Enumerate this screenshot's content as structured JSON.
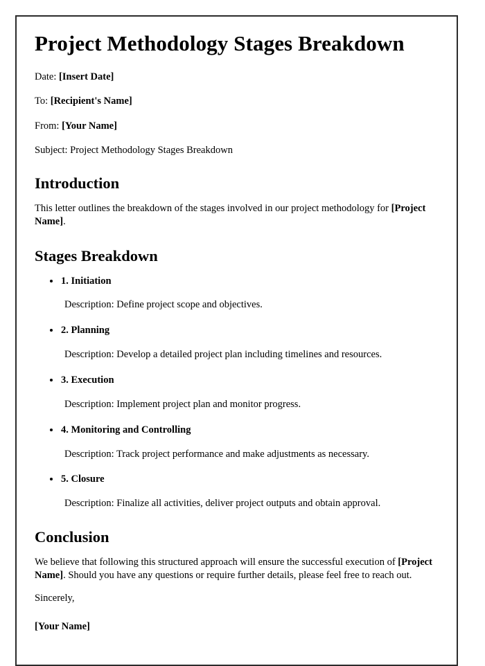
{
  "document": {
    "title": "Project Methodology Stages Breakdown",
    "meta": [
      {
        "label": "Date:",
        "value": "[Insert Date]",
        "value_bold": true
      },
      {
        "label": "To:",
        "value": "[Recipient's Name]",
        "value_bold": true
      },
      {
        "label": "From:",
        "value": "[Your Name]",
        "value_bold": true
      },
      {
        "label": "Subject:",
        "value": "Project Methodology Stages Breakdown",
        "value_bold": false
      }
    ],
    "introduction": {
      "heading": "Introduction",
      "text_before": "This letter outlines the breakdown of the stages involved in our project methodology for ",
      "text_bold": "[Project Name]",
      "text_after": "."
    },
    "stages_section": {
      "heading": "Stages Breakdown",
      "description_prefix": "Description: ",
      "stages": [
        {
          "title": "1. Initiation",
          "description": "Description: Define project scope and objectives."
        },
        {
          "title": "2. Planning",
          "description": "Description: Develop a detailed project plan including timelines and resources."
        },
        {
          "title": "3. Execution",
          "description": "Description: Implement project plan and monitor progress."
        },
        {
          "title": "4. Monitoring and Controlling",
          "description": "Description: Track project performance and make adjustments as necessary."
        },
        {
          "title": "5. Closure",
          "description": "Description: Finalize all activities, deliver project outputs and obtain approval."
        }
      ]
    },
    "conclusion": {
      "heading": "Conclusion",
      "text_before": "We believe that following this structured approach will ensure the successful execution of ",
      "text_bold": "[Project Name]",
      "text_after": ". Should you have any questions or require further details, please feel free to reach out.",
      "closing": "Sincerely,",
      "signature": "[Your Name]"
    }
  },
  "colors": {
    "page_border": "#2b2b2b",
    "text": "#000000",
    "background": "#ffffff"
  }
}
